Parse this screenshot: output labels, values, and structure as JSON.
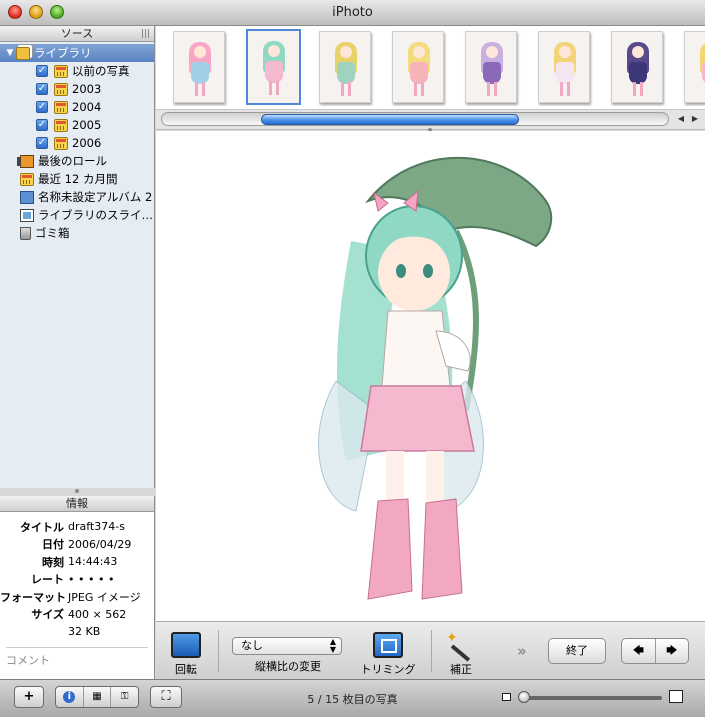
{
  "window": {
    "title": "iPhoto"
  },
  "sidebar": {
    "header": "ソース",
    "items": [
      {
        "label": "ライブラリ",
        "icon": "library-icon",
        "selected": true,
        "indent": 0
      },
      {
        "label": "以前の写真",
        "icon": "calendar-icon",
        "checked": true,
        "indent": 1
      },
      {
        "label": "2003",
        "icon": "calendar-icon",
        "checked": true,
        "indent": 1
      },
      {
        "label": "2004",
        "icon": "calendar-icon",
        "checked": true,
        "indent": 1
      },
      {
        "label": "2005",
        "icon": "calendar-icon",
        "checked": true,
        "indent": 1
      },
      {
        "label": "2006",
        "icon": "calendar-icon",
        "checked": true,
        "indent": 1
      },
      {
        "label": "最後のロール",
        "icon": "film-roll-icon",
        "indent": 0
      },
      {
        "label": "最近 12 カ月間",
        "icon": "calendar-icon",
        "indent": 0
      },
      {
        "label": "名称未設定アルバム 2",
        "icon": "album-icon",
        "indent": 0
      },
      {
        "label": "ライブラリのスライ…",
        "icon": "slideshow-icon",
        "indent": 0
      },
      {
        "label": "ゴミ箱",
        "icon": "trash-icon",
        "indent": 0
      }
    ]
  },
  "info": {
    "header": "情報",
    "rows": [
      {
        "key": "タイトル",
        "value": "draft374-s"
      },
      {
        "key": "日付",
        "value": "2006/04/29"
      },
      {
        "key": "時刻",
        "value": "14:44:43"
      },
      {
        "key": "レート",
        "value": "• • • • •"
      },
      {
        "key": "フォーマット",
        "value": "JPEG イメージ"
      },
      {
        "key": "サイズ",
        "value": "400 × 562"
      },
      {
        "key": "",
        "value": "32 KB"
      }
    ],
    "comment_placeholder": "コメント"
  },
  "filmstrip": {
    "thumbs": [
      {
        "hair": "#f7a7c6",
        "dress": "#9fd0e8"
      },
      {
        "hair": "#8fd9c4",
        "dress": "#f4b8cf",
        "selected": true
      },
      {
        "hair": "#e8d26a",
        "dress": "#9fd3c0"
      },
      {
        "hair": "#f2dc7c",
        "dress": "#f6b4b8"
      },
      {
        "hair": "#c7b0e0",
        "dress": "#8a6ab8"
      },
      {
        "hair": "#f4d47a",
        "dress": "#f4e6f0"
      },
      {
        "hair": "#5a4a8c",
        "dress": "#3c3878"
      },
      {
        "hair": "#f2d670",
        "dress": "#f6b7c8"
      }
    ]
  },
  "edit_toolbar": {
    "rotate_label": "回転",
    "aspect_value": "なし",
    "aspect_label": "縦横比の変更",
    "crop_label": "トリミング",
    "enhance_label": "補正",
    "more": "»",
    "done_label": "終了",
    "prev_arrow": "🡄",
    "next_arrow": "🡆"
  },
  "bottom_bar": {
    "add": "+",
    "fullscreen": "⛶",
    "status": "5 / 15 枚目の写真",
    "info_glyph": "i",
    "zoom_level": 0.0
  },
  "colors": {
    "selection": "#5a84c4",
    "accent": "#4f86d8"
  }
}
